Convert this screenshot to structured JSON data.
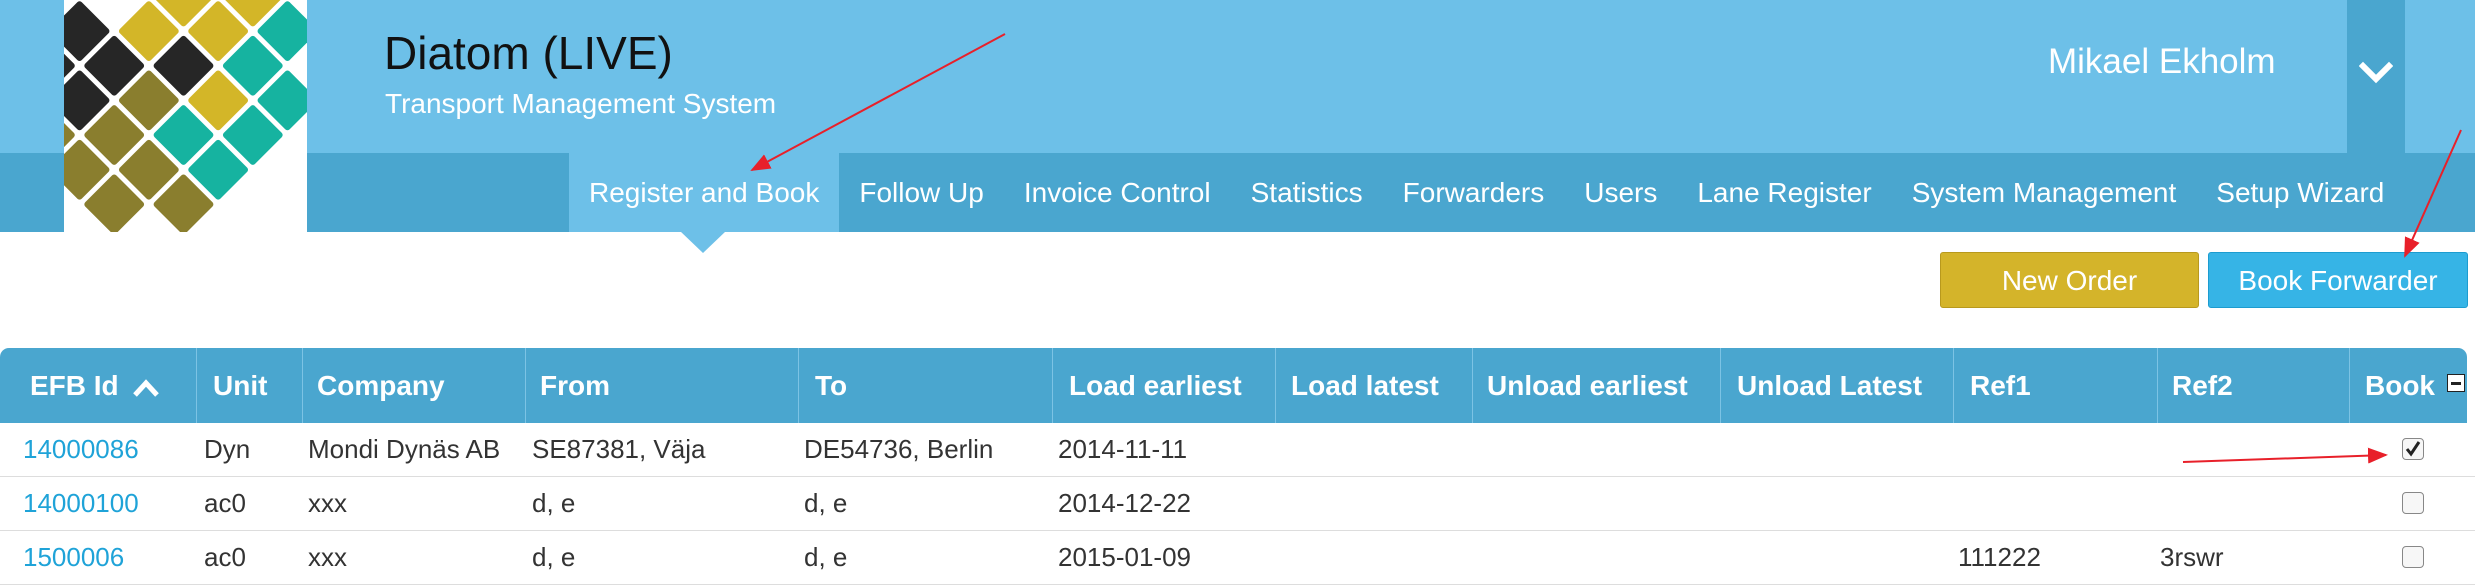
{
  "app": {
    "title": "Diatom (LIVE)",
    "subtitle": "Transport Management System",
    "user_name": "Mikael Ekholm"
  },
  "nav": {
    "items": [
      {
        "label": "Register and Book",
        "active": true
      },
      {
        "label": "Follow Up"
      },
      {
        "label": "Invoice Control"
      },
      {
        "label": "Statistics"
      },
      {
        "label": "Forwarders"
      },
      {
        "label": "Users"
      },
      {
        "label": "Lane Register"
      },
      {
        "label": "System Management"
      },
      {
        "label": "Setup Wizard"
      }
    ]
  },
  "actions": {
    "new_order": "New Order",
    "book_forwarder": "Book Forwarder"
  },
  "table": {
    "columns": [
      "EFB Id",
      "Unit",
      "Company",
      "From",
      "To",
      "Load earliest",
      "Load latest",
      "Unload earliest",
      "Unload Latest",
      "Ref1",
      "Ref2",
      "Book"
    ],
    "sort": {
      "column": "EFB Id",
      "direction": "asc"
    },
    "rows": [
      {
        "efb_id": "14000086",
        "unit": "Dyn",
        "company": "Mondi Dynäs AB",
        "from": "SE87381, Väja",
        "to": "DE54736, Berlin",
        "load_earliest": "2014-11-11",
        "load_latest": "",
        "unload_earliest": "",
        "unload_latest": "",
        "ref1": "",
        "ref2": "",
        "book": true
      },
      {
        "efb_id": "14000100",
        "unit": "ac0",
        "company": "xxx",
        "from": "d, e",
        "to": "d, e",
        "load_earliest": "2014-12-22",
        "load_latest": "",
        "unload_earliest": "",
        "unload_latest": "",
        "ref1": "",
        "ref2": "",
        "book": false
      },
      {
        "efb_id": "1500006",
        "unit": "ac0",
        "company": "xxx",
        "from": "d, e",
        "to": "d, e",
        "load_earliest": "2015-01-09",
        "load_latest": "",
        "unload_earliest": "",
        "unload_latest": "",
        "ref1": "111222",
        "ref2": "3rswr",
        "book": false
      }
    ]
  },
  "colors": {
    "header_light": "#6dc0e8",
    "header_dark": "#4aa6cf",
    "link": "#1fa3d8",
    "new_order_button": "#d4b42a",
    "book_forwarder_button": "#36b4e6",
    "annotation_arrow": "#e8202a"
  }
}
